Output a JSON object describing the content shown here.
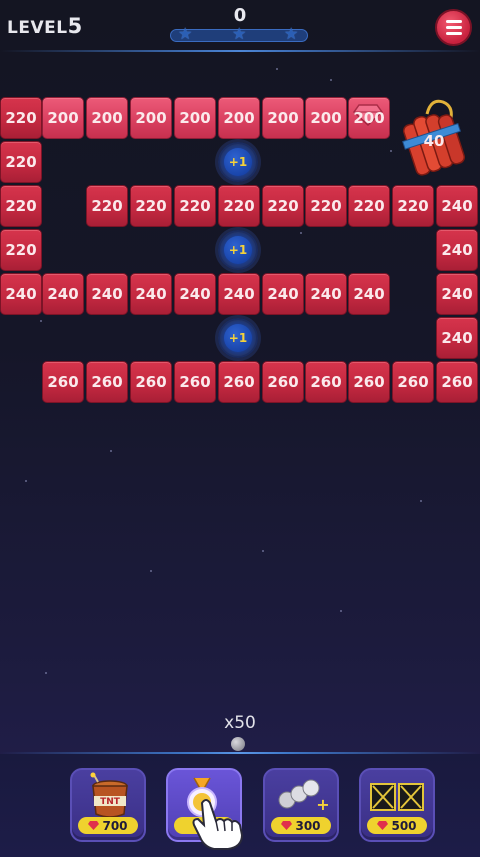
{
  "hud": {
    "level_prefix": "LEVEL",
    "level_number": "5",
    "score": "0",
    "progress": 0.0,
    "stars_total": 3
  },
  "board": {
    "row1": [
      "220",
      "200",
      "200",
      "200",
      "200",
      "200",
      "200",
      "200",
      "200"
    ],
    "row2": [
      "220"
    ],
    "row3": [
      "220",
      "220",
      "220",
      "220",
      "220",
      "220",
      "220",
      "220",
      "220",
      "240"
    ],
    "row4": [
      "220",
      "240"
    ],
    "row5": [
      "240",
      "240",
      "240",
      "240",
      "240",
      "240",
      "240",
      "240",
      "240",
      "240"
    ],
    "row6": [
      "240"
    ],
    "row7": [
      "260",
      "260",
      "260",
      "260",
      "260",
      "260",
      "260",
      "260",
      "260",
      "260"
    ],
    "bonus_label": "+1",
    "tnt_value": "40"
  },
  "launcher": {
    "ball_count": "x50"
  },
  "powerups": [
    {
      "name": "tnt",
      "icon": "tnt-barrel-icon",
      "price": "700"
    },
    {
      "name": "golden-ball",
      "icon": "golden-ball-icon",
      "price": "",
      "selected": true
    },
    {
      "name": "extra-balls",
      "icon": "extra-balls-icon",
      "price": "300"
    },
    {
      "name": "laser-blocks",
      "icon": "laser-blocks-icon",
      "price": "500"
    }
  ],
  "colors": {
    "brick": "#c82a42",
    "brick_highlight": "#e04d6b",
    "bonus": "#1f4fb8",
    "price_pill": "#efd22e",
    "powerup_bg": "#4a3fa0"
  }
}
